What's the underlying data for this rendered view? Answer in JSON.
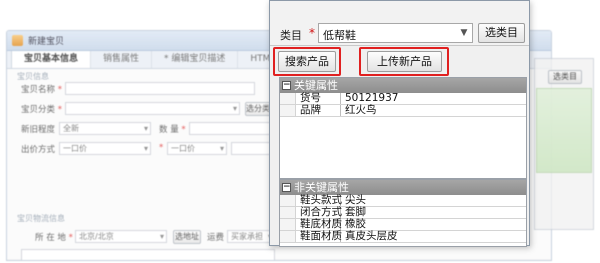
{
  "background_window": {
    "title": "新建宝贝",
    "tabs": [
      "宝贝基本信息",
      "销售属性",
      "* 编辑宝贝描述",
      "HTML源码"
    ],
    "section_title": "宝贝信息",
    "fields": {
      "name_label": "宝贝名称",
      "category_label": "宝贝分类",
      "category_button": "选分类",
      "stock_label": "新旧程度",
      "stock_value": "全新",
      "quantity_label": "数 量",
      "shipping_label": "出价方式",
      "shipping_value": "一口价",
      "price_value": "一口价"
    },
    "section2_title": "宝贝物流信息",
    "freight_label": "所 在 地",
    "freight_value": "北京/北京",
    "freight_button": "选地址",
    "template_label": "运费",
    "template_value": "买家承担",
    "right_button": "选类目"
  },
  "dialog": {
    "category_label": "类目",
    "required_mark": "*",
    "category_value": "低帮鞋",
    "choose_button": "选类目",
    "search_button": "搜索产品",
    "upload_button": "上传新产品",
    "key_props": {
      "header": "关键属性",
      "collapse": "−",
      "rows": [
        {
          "name": "货号",
          "value": "50121937"
        },
        {
          "name": "品牌",
          "value": "红火鸟"
        }
      ]
    },
    "nonkey_props": {
      "header": "非关键属性",
      "collapse": "−",
      "rows": [
        {
          "name": "鞋头款式",
          "value": "尖头"
        },
        {
          "name": "闭合方式",
          "value": "套脚"
        },
        {
          "name": "鞋底材质",
          "value": "橡胶"
        },
        {
          "name": "鞋面材质",
          "value": "真皮头层皮"
        }
      ]
    }
  },
  "colors": {
    "highlight": "#e02020",
    "grid_header": "#9a9a9a",
    "required": "#d01010"
  }
}
